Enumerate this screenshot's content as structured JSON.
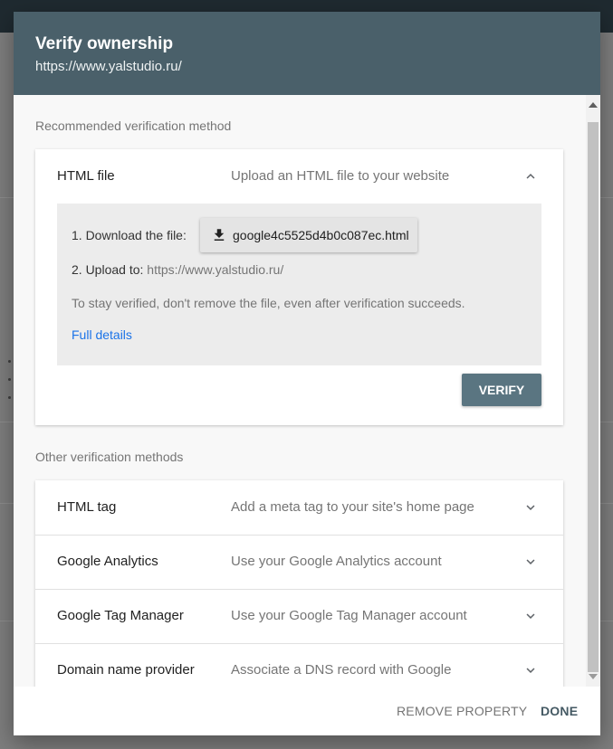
{
  "dialog": {
    "title": "Verify ownership",
    "subtitle": "https://www.yalstudio.ru/"
  },
  "recommended": {
    "section_label": "Recommended verification method",
    "method": {
      "title": "HTML file",
      "description": "Upload an HTML file to your website",
      "expanded": true,
      "chevron_icon": "chevron-up-icon",
      "step1_label": "1. Download the file:",
      "file_name": "google4c5525d4b0c087ec.html",
      "download_icon": "download-icon",
      "step2_label": "2. Upload to:",
      "upload_url": "https://www.yalstudio.ru/",
      "note": "To stay verified, don't remove the file, even after verification succeeds.",
      "details_link": "Full details",
      "verify_label": "VERIFY"
    }
  },
  "other": {
    "section_label": "Other verification methods",
    "methods": [
      {
        "title": "HTML tag",
        "description": "Add a meta tag to your site's home page"
      },
      {
        "title": "Google Analytics",
        "description": "Use your Google Analytics account"
      },
      {
        "title": "Google Tag Manager",
        "description": "Use your Google Tag Manager account"
      },
      {
        "title": "Domain name provider",
        "description": "Associate a DNS record with Google"
      }
    ]
  },
  "footer": {
    "remove_label": "REMOVE PROPERTY",
    "done_label": "DONE"
  },
  "colors": {
    "header": "#4a606a",
    "verify_button": "#5a7581",
    "link": "#1a73e8"
  }
}
